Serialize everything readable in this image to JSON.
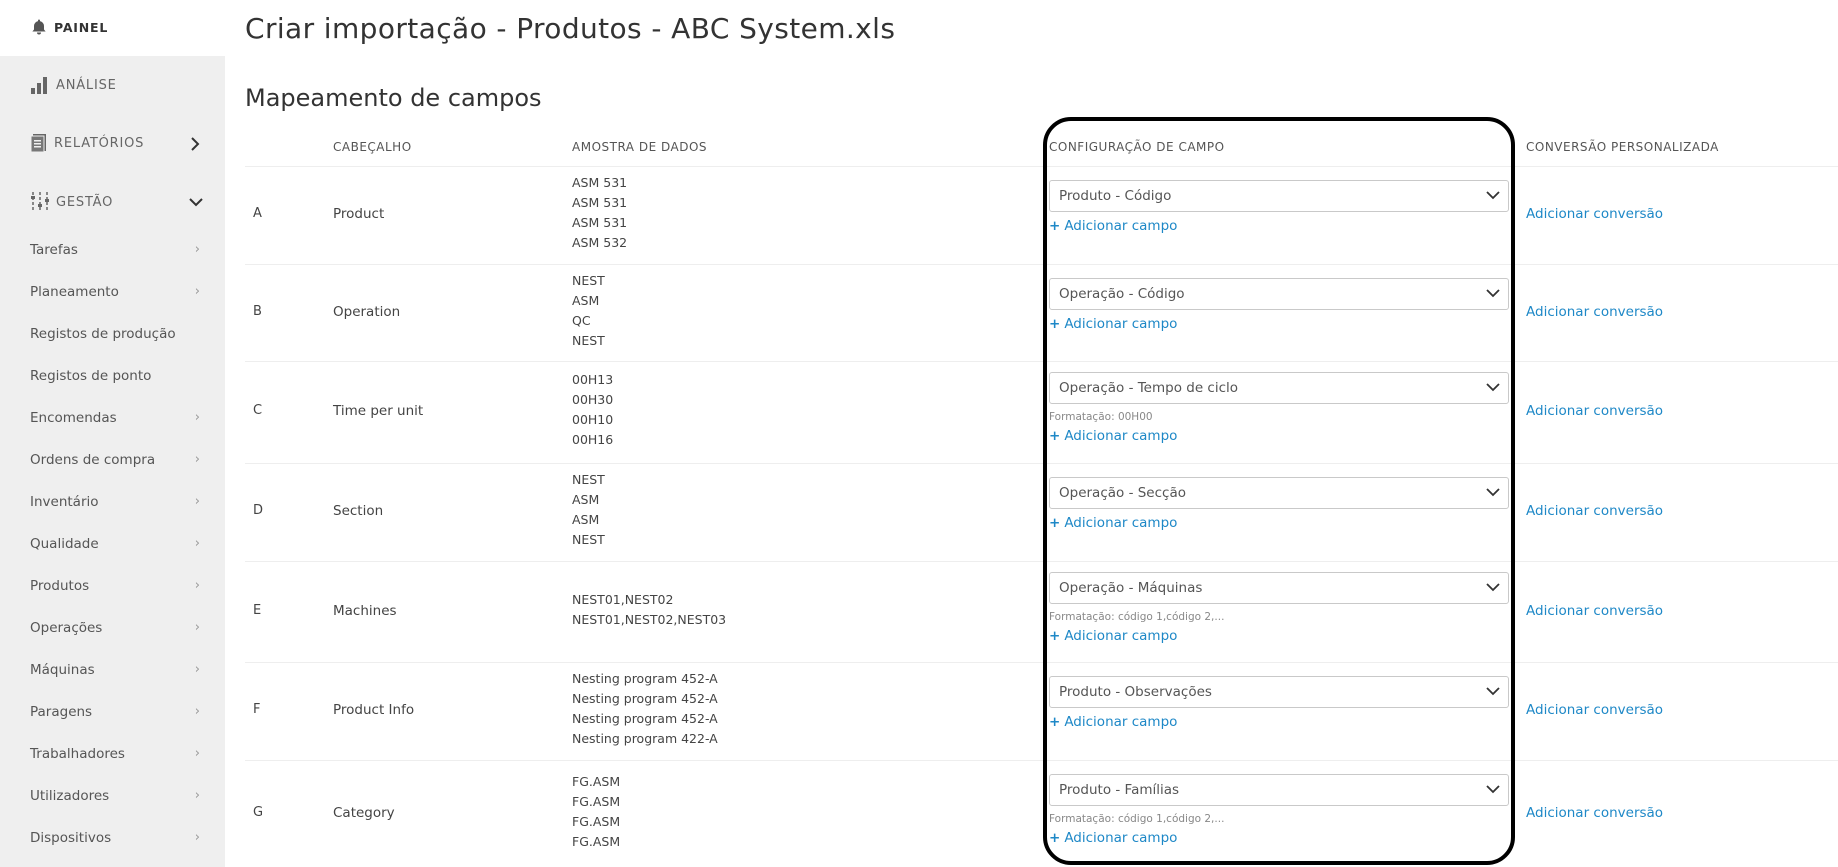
{
  "sidebar": {
    "painel": "PAINEL",
    "analise": "ANÁLISE",
    "relatorios": "RELATÓRIOS",
    "gestao": "GESTÃO",
    "sub_items": [
      "Tarefas",
      "Planeamento",
      "Registos de produção",
      "Registos de ponto",
      "Encomendas",
      "Ordens de compra",
      "Inventário",
      "Qualidade",
      "Produtos",
      "Operações",
      "Máquinas",
      "Paragens",
      "Trabalhadores",
      "Utilizadores",
      "Dispositivos"
    ]
  },
  "page_title": "Criar importação - Produtos - ABC System.xls",
  "section_title": "Mapeamento de campos",
  "columns": {
    "header": "CABEÇALHO",
    "sample": "AMOSTRA DE DADOS",
    "config": "CONFIGURAÇÃO DE CAMPO",
    "conversion": "CONVERSÃO PERSONALIZADA"
  },
  "add_field_label": "Adicionar campo",
  "add_conversion_label": "Adicionar conversão",
  "rows": [
    {
      "letter": "A",
      "header": "Product",
      "sample": [
        "ASM 531",
        "ASM 531",
        "ASM 531",
        "ASM 532"
      ],
      "field": "Produto - Código",
      "format": ""
    },
    {
      "letter": "B",
      "header": "Operation",
      "sample": [
        "NEST",
        "ASM",
        "QC",
        "NEST"
      ],
      "field": "Operação - Código",
      "format": ""
    },
    {
      "letter": "C",
      "header": "Time per unit",
      "sample": [
        "00H13",
        "00H30",
        "00H10",
        "00H16"
      ],
      "field": "Operação - Tempo de ciclo",
      "format": "Formatação: 00H00"
    },
    {
      "letter": "D",
      "header": "Section",
      "sample": [
        "NEST",
        "ASM",
        "ASM",
        "NEST"
      ],
      "field": "Operação - Secção",
      "format": ""
    },
    {
      "letter": "E",
      "header": "Machines",
      "sample": [
        "NEST01,NEST02",
        "NEST01,NEST02,NEST03"
      ],
      "field": "Operação - Máquinas",
      "format": "Formatação: código 1,código 2,..."
    },
    {
      "letter": "F",
      "header": "Product Info",
      "sample": [
        "Nesting program 452-A",
        "Nesting program 452-A",
        "Nesting program 452-A",
        "Nesting program 422-A"
      ],
      "field": "Produto - Observações",
      "format": ""
    },
    {
      "letter": "G",
      "header": "Category",
      "sample": [
        "FG.ASM",
        "FG.ASM",
        "FG.ASM",
        "FG.ASM"
      ],
      "field": "Produto - Famílias",
      "format": "Formatação: código 1,código 2,..."
    }
  ],
  "colors": {
    "link": "#1e88c7",
    "sidebar_bg": "#efefef",
    "highlight": "#000000"
  }
}
